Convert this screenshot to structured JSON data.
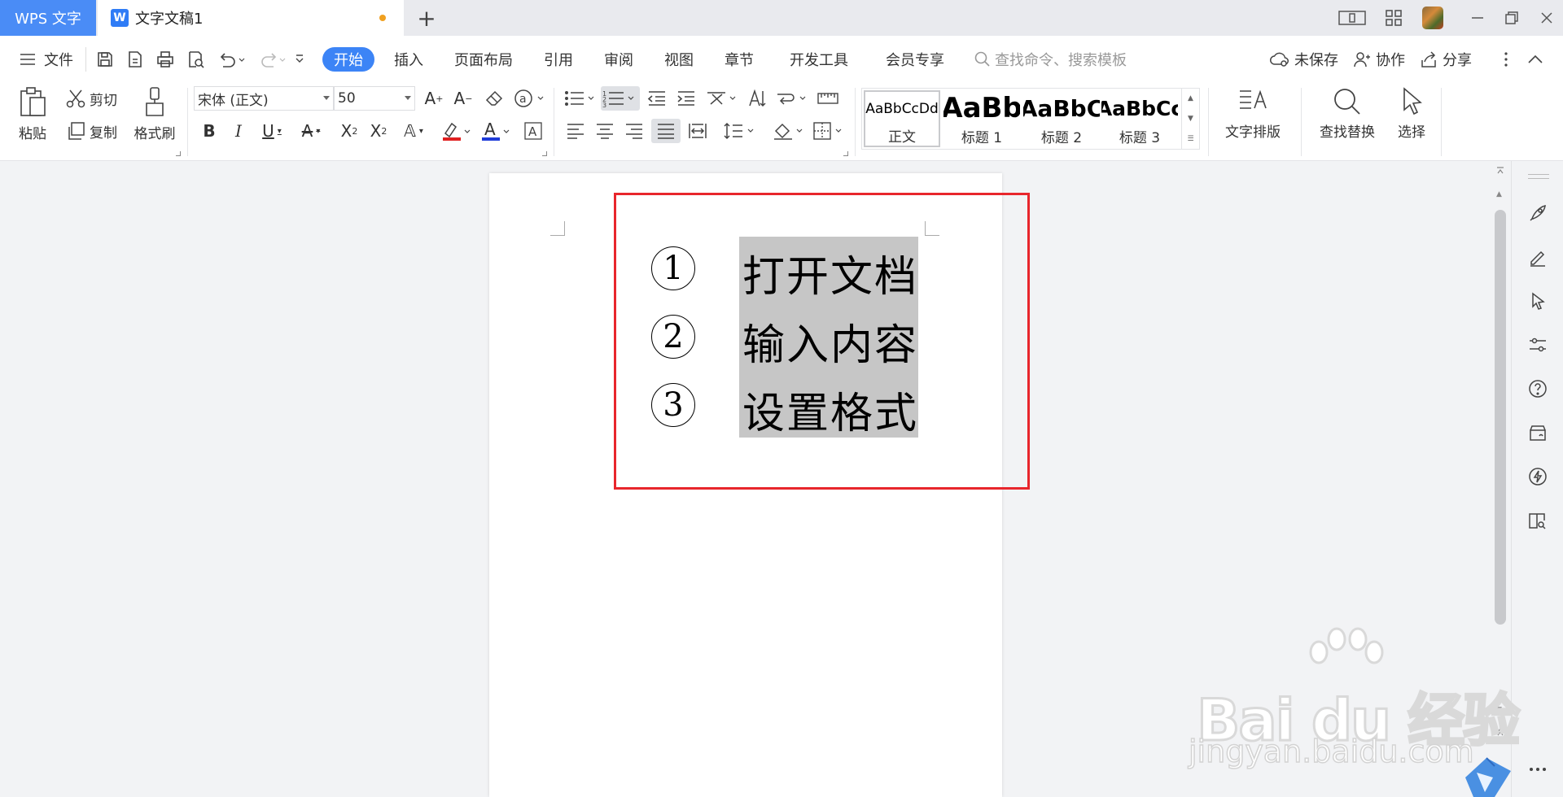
{
  "titlebar": {
    "app_label": "WPS 文字",
    "doc_tab_title": "文字文稿1",
    "new_tab_symbol": "+"
  },
  "menubar": {
    "file_label": "文件",
    "tabs": [
      "开始",
      "插入",
      "页面布局",
      "引用",
      "审阅",
      "视图",
      "章节",
      "开发工具",
      "会员专享"
    ],
    "active_tab": "开始",
    "search_placeholder": "查找命令、搜索模板",
    "unsaved_label": "未保存",
    "collab_label": "协作",
    "share_label": "分享"
  },
  "ribbon": {
    "paste_label": "粘贴",
    "cut_label": "剪切",
    "copy_label": "复制",
    "format_painter_label": "格式刷",
    "font_name": "宋体 (正文)",
    "font_size": "50",
    "styles": [
      {
        "sample": "AaBbCcDd",
        "name": "正文"
      },
      {
        "sample": "AaBb",
        "name": "标题 1"
      },
      {
        "sample": "AaBbC",
        "name": "标题 2"
      },
      {
        "sample": "AaBbCc",
        "name": "标题 3"
      }
    ],
    "text_layout_label": "文字排版",
    "find_replace_label": "查找替换",
    "select_label": "选择"
  },
  "document": {
    "items": [
      {
        "number": "1",
        "text": "打开文档"
      },
      {
        "number": "2",
        "text": "输入内容"
      },
      {
        "number": "3",
        "text": "设置格式"
      }
    ]
  },
  "watermark": {
    "logo_text": "Bai du 经验",
    "url_text": "jingyan.baidu.com"
  },
  "colors": {
    "accent": "#3c84f6",
    "app_tab": "#4a8cf6",
    "highlight_border": "#e8262c",
    "selection": "#c6c6c6"
  }
}
